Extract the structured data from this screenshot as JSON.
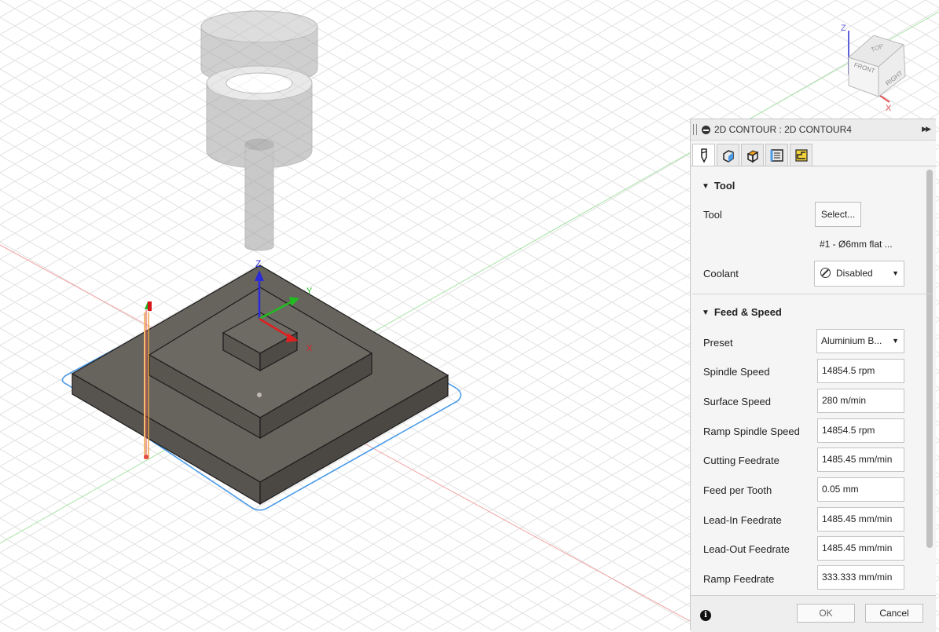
{
  "viewcube": {
    "axis_z": "Z",
    "axis_x": "X",
    "face_top": "TOP",
    "face_front": "FRONT",
    "face_right": "RIGHT"
  },
  "gizmo": {
    "z": "Z",
    "y": "Y",
    "x": "X"
  },
  "panel": {
    "title": "2D CONTOUR : 2D CONTOUR4",
    "tabs": [
      {
        "icon": "tool-icon",
        "active": true
      },
      {
        "icon": "geometry-icon"
      },
      {
        "icon": "heights-icon"
      },
      {
        "icon": "passes-icon"
      },
      {
        "icon": "linking-icon"
      }
    ],
    "tool_section": {
      "header": "Tool",
      "tool_label": "Tool",
      "select_button": "Select...",
      "tool_name": "#1 - Ø6mm flat ...",
      "coolant_label": "Coolant",
      "coolant_value": "Disabled"
    },
    "feed_section": {
      "header": "Feed & Speed",
      "preset_label": "Preset",
      "preset_value": "Aluminium B...",
      "fields": [
        {
          "label": "Spindle Speed",
          "value": "14854.5 rpm"
        },
        {
          "label": "Surface Speed",
          "value": "280 m/min"
        },
        {
          "label": "Ramp Spindle Speed",
          "value": "14854.5 rpm"
        },
        {
          "label": "Cutting Feedrate",
          "value": "1485.45 mm/min"
        },
        {
          "label": "Feed per Tooth",
          "value": "0.05 mm"
        },
        {
          "label": "Lead-In Feedrate",
          "value": "1485.45 mm/min"
        },
        {
          "label": "Lead-Out Feedrate",
          "value": "1485.45 mm/min"
        },
        {
          "label": "Ramp Feedrate",
          "value": "333.333 mm/min"
        }
      ]
    },
    "footer": {
      "ok": "OK",
      "cancel": "Cancel"
    }
  },
  "colors": {
    "accent_selection": "#4a9be8",
    "axis_red": "#e53935",
    "axis_green": "#3dbb3d",
    "axis_blue": "#2a2ad8",
    "stock": "#66625c"
  }
}
